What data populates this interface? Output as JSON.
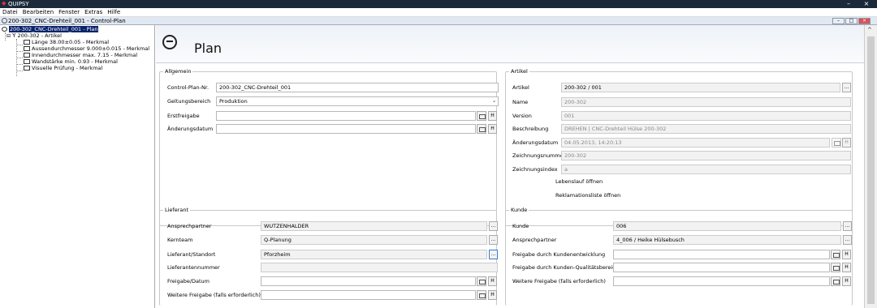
{
  "window": {
    "title": "QUIPSY"
  },
  "menu": [
    "Datei",
    "Bearbeiten",
    "Fenster",
    "Extras",
    "Hilfe"
  ],
  "document": {
    "title": "200-302_CNC-Drehteil_001 - Control-Plan"
  },
  "tree": {
    "root": "200-302_CNC-Drehteil_001 - Plan",
    "article": "200-302 - Artikel",
    "features": [
      "Länge 38.00±0.05 - Merkmal",
      "Aussendurchmesser 9.000±0.015 - Merkmal",
      "Innendurchmesser max. 7.15 - Merkmal",
      "Wandstärke min. 0.93 - Merkmal",
      "Visuelle Prüfung - Merkmal"
    ]
  },
  "header": {
    "title": "Plan"
  },
  "allgemein": {
    "legend": "Allgemein",
    "control_plan_label": "Control-Plan-Nr.",
    "control_plan_value": "200-302_CNC-Drehteil_001",
    "geltungsbereich_label": "Geltungsbereich",
    "geltungsbereich_value": "Produktion",
    "erstfreigabe_label": "Erstfreigabe",
    "erstfreigabe_value": "",
    "aenderungsdatum_label": "Änderungsdatum",
    "aenderungsdatum_value": ""
  },
  "artikel": {
    "legend": "Artikel",
    "artikel_label": "Artikel",
    "artikel_value": "200-302 / 001",
    "name_label": "Name",
    "name_value": "200-302",
    "version_label": "Version",
    "version_value": "001",
    "beschreibung_label": "Beschreibung",
    "beschreibung_value": "DREHEN | CNC-Drehteil Hülse 200-302",
    "aenderungsdatum_label": "Änderungsdatum",
    "aenderungsdatum_value": "04.05.2013, 14:20:13",
    "zeichnungsnummer_label": "Zeichnungsnummer",
    "zeichnungsnummer_value": "200-302",
    "zeichnungsindex_label": "Zeichnungsindex",
    "zeichnungsindex_value": "a",
    "lebenslauf_link": "Lebenslauf öffnen",
    "reklamation_link": "Reklamationsliste öffnen"
  },
  "lieferant": {
    "legend": "Lieferant",
    "ansprechpartner_label": "Ansprechpartner",
    "ansprechpartner_value": "WUTZENHALDER",
    "kernteam_label": "Kernteam",
    "kernteam_value": "Q-Planung",
    "standort_label": "Lieferant/Standort",
    "standort_value": "Pforzheim",
    "nummer_label": "Lieferantennummer",
    "nummer_value": "",
    "freigabe_label": "Freigabe/Datum",
    "freigabe_value": "",
    "weitere_label": "Weitere Freigabe (falls erforderlich)",
    "weitere_value": ""
  },
  "kunde": {
    "legend": "Kunde",
    "kunde_label": "Kunde",
    "kunde_value": "006",
    "ansprechpartner_label": "Ansprechpartner",
    "ansprechpartner_value": "4_006 / Heike Hülsebusch",
    "entwicklung_label": "Freigabe durch Kundenentwicklung",
    "entwicklung_value": "",
    "qualitaet_label": "Freigabe durch Kunden-Qualitätsbereich",
    "qualitaet_value": "",
    "weitere_label": "Weitere Freigabe (falls erforderlich)",
    "weitere_value": ""
  },
  "buttons": {
    "dots": "...",
    "h": "H",
    "minimize": "–",
    "maximize": "□",
    "close": "×"
  }
}
